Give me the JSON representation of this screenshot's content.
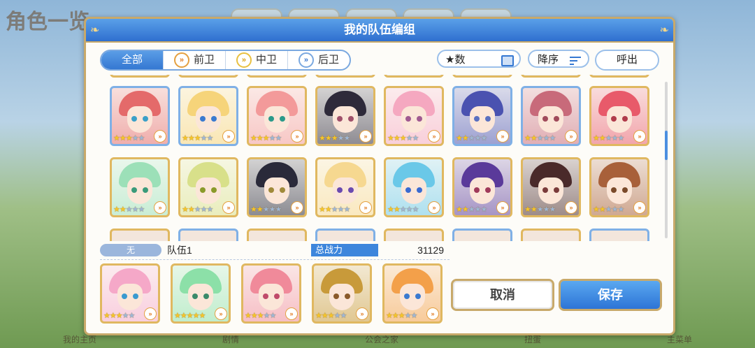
{
  "background": {
    "title": "角色一览",
    "bottom_nav": [
      "我的主页",
      "剧情",
      "公会之家",
      "扭蛋",
      "主菜单"
    ]
  },
  "dialog": {
    "title": "我的队伍编组",
    "filters": [
      {
        "label": "全部",
        "active": true,
        "icon": ""
      },
      {
        "label": "前卫",
        "active": false,
        "icon": "front-chevron-icon"
      },
      {
        "label": "中卫",
        "active": false,
        "icon": "middle-chevron-icon"
      },
      {
        "label": "后卫",
        "active": false,
        "icon": "back-chevron-icon"
      }
    ],
    "sort_key_label": "★数",
    "order_label": "降序",
    "call_label": "呼出",
    "roster": [
      {
        "stars": 3,
        "frame": "blue",
        "hair": "#e46a6a",
        "eye": "#3aa0c8"
      },
      {
        "stars": 3,
        "frame": "blue",
        "hair": "#f6d47a",
        "eye": "#3a7ad0"
      },
      {
        "stars": 3,
        "frame": "gold",
        "hair": "#f39a9a",
        "eye": "#2a9a8a"
      },
      {
        "stars": 3,
        "frame": "gold",
        "hair": "#2e2a3a",
        "eye": "#a0506a"
      },
      {
        "stars": 3,
        "frame": "gold",
        "hair": "#f5a8c0",
        "eye": "#a05a90"
      },
      {
        "stars": 2,
        "frame": "blue",
        "hair": "#4a52b0",
        "eye": "#5a70c0"
      },
      {
        "stars": 2,
        "frame": "blue",
        "hair": "#c86a7a",
        "eye": "#a04a5a"
      },
      {
        "stars": 2,
        "frame": "gold",
        "hair": "#e85a6a",
        "eye": "#b03a4a"
      },
      {
        "stars": 2,
        "frame": "gold",
        "hair": "#9ce0b8",
        "eye": "#3a9a7a"
      },
      {
        "stars": 2,
        "frame": "gold",
        "hair": "#d8e08a",
        "eye": "#8a9a2a"
      },
      {
        "stars": 2,
        "frame": "gold",
        "hair": "#2a2a3a",
        "eye": "#a08a3a"
      },
      {
        "stars": 2,
        "frame": "gold",
        "hair": "#f6d890",
        "eye": "#6a4ab0"
      },
      {
        "stars": 2,
        "frame": "gold",
        "hair": "#6ac8e8",
        "eye": "#3a6ad0"
      },
      {
        "stars": 2,
        "frame": "gold",
        "hair": "#5a3a9a",
        "eye": "#a03a5a"
      },
      {
        "stars": 2,
        "frame": "gold",
        "hair": "#4a2a2a",
        "eye": "#7a3a3a"
      },
      {
        "stars": 2,
        "frame": "gold",
        "hair": "#a8603a",
        "eye": "#7a4a2a"
      }
    ],
    "team": {
      "tag": "无",
      "name": "队伍1",
      "power_label": "总战力",
      "power_value": "31129",
      "members": [
        {
          "stars": 3,
          "hair": "#f5a8c8",
          "eye": "#3a9ad0"
        },
        {
          "stars": 5,
          "hair": "#8ce0a8",
          "eye": "#3a8a6a"
        },
        {
          "stars": 3,
          "hair": "#f08a9a",
          "eye": "#c04a6a"
        },
        {
          "stars": 3,
          "hair": "#c89a3a",
          "eye": "#8a5a2a"
        },
        {
          "stars": 3,
          "hair": "#f3a04a",
          "eye": "#3a7ad0"
        }
      ]
    },
    "cancel_label": "取消",
    "save_label": "保存"
  }
}
